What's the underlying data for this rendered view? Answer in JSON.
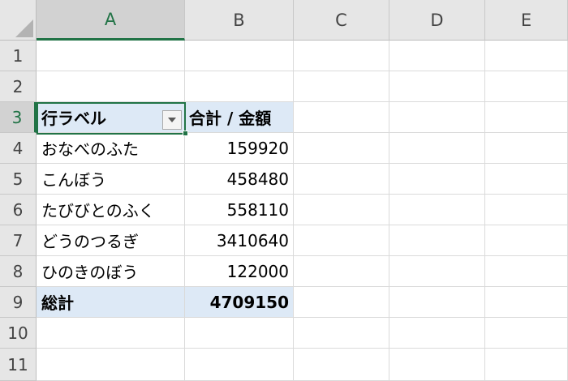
{
  "columns": [
    "A",
    "B",
    "C",
    "D",
    "E"
  ],
  "rows": [
    "1",
    "2",
    "3",
    "4",
    "5",
    "6",
    "7",
    "8",
    "9",
    "10",
    "11"
  ],
  "pivot": {
    "header_label": "行ラベル",
    "header_value": "合計 / 金額",
    "items": [
      {
        "label": "おなべのふた",
        "value": "159920"
      },
      {
        "label": "こんぼう",
        "value": "458480"
      },
      {
        "label": "たびびとのふく",
        "value": "558110"
      },
      {
        "label": "どうのつるぎ",
        "value": "3410640"
      },
      {
        "label": "ひのきのぼう",
        "value": "122000"
      }
    ],
    "total_label": "総計",
    "total_value": "4709150"
  },
  "filter_icon": "dropdown-arrow-icon",
  "colors": {
    "accent": "#217346",
    "pivot_header_fill": "#dde9f6",
    "header_fill": "#e6e6e6"
  }
}
